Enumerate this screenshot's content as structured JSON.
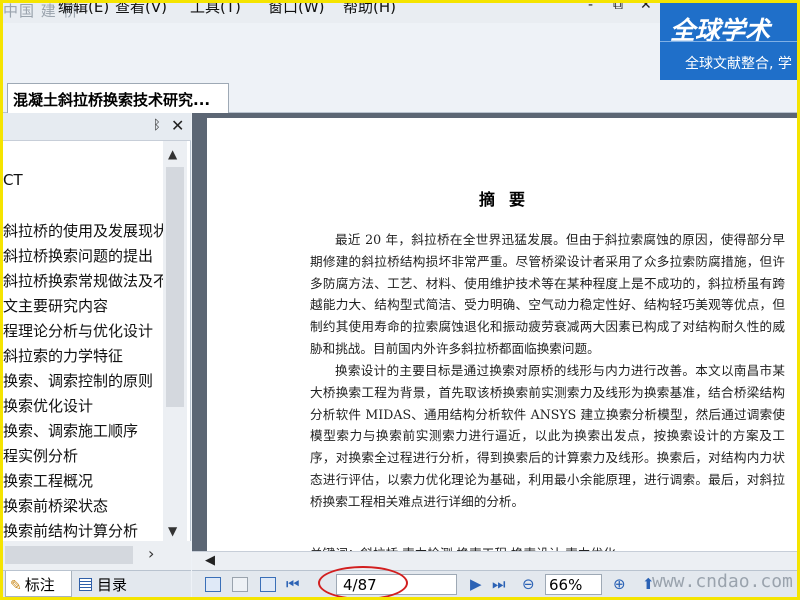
{
  "watermark_top": "中国 建 桥",
  "menu": [
    "编辑(E)",
    "查看(V)",
    "工具(T)",
    "窗口(W)",
    "帮助(H)"
  ],
  "window_controls": {
    "minimize": "-",
    "restore": "⧉",
    "close": "✕"
  },
  "banner": {
    "logo": "全球学术",
    "subtitle": "全球文献整合, 学"
  },
  "doc_tab": {
    "title": "混凝土斜拉桥换索技术研究..."
  },
  "panel": {
    "pin": "ᛒ",
    "close": "✕",
    "toc": [
      "CT",
      "斜拉桥的使用及发展现状",
      "斜拉桥换索问题的提出",
      "斜拉桥换索常规做法及不足",
      "文主要研究内容",
      "程理论分析与优化设计",
      "斜拉索的力学特征",
      "换索、调索控制的原则",
      "换索优化设计",
      "换索、调索施工顺序",
      "程实例分析",
      "换索工程概况",
      "换索前桥梁状态",
      "换索前结构计算分析"
    ],
    "tabs": [
      {
        "label": "标注",
        "icon": "pen-icon"
      },
      {
        "label": "目录",
        "icon": "grid-icon"
      }
    ]
  },
  "page": {
    "title": "摘要",
    "paragraphs": [
      "最近 20 年，斜拉桥在全世界迅猛发展。但由于斜拉索腐蚀的原因，使得部分早期修建的斜拉桥结构损坏非常严重。尽管桥梁设计者采用了众多拉索防腐措施，但许多防腐方法、工艺、材料、使用维护技术等在某种程度上是不成功的，斜拉桥虽有跨越能力大、结构型式简洁、受力明确、空气动力稳定性好、结构轻巧美观等优点，但制约其使用寿命的拉索腐蚀退化和振动疲劳衰减两大因素已构成了对结构耐久性的威胁和挑战。目前国内外许多斜拉桥都面临换索问题。",
      "换索设计的主要目标是通过换索对原桥的线形与内力进行改善。本文以南昌市某大桥换索工程为背景，首先取该桥换索前实测索力及线形为换索基准，结合桥梁结构分析软件 MIDAS、通用结构分析软件 ANSYS 建立换索分析模型，然后通过调索使模型索力与换索前实测索力进行逼近，以此为换索出发点，按换索设计的方案及工序，对换索全过程进行分析，得到换索后的计算索力及线形。换索后，对结构内力状态进行评估，以索力优化理论为基础，利用最小余能原理，进行调索。最后，对斜拉桥换索工程相关难点进行详细的分析。"
    ],
    "keywords": "关键词：斜拉桥     索力检测     换索工程     换索设计     索力优化"
  },
  "status": {
    "page": "4/87",
    "zoom": "66%",
    "watermark": "www.cndao.com"
  },
  "colors": {
    "frame": "#f5e400",
    "banner": "#1f6fc9",
    "highlight_ring": "#d21f1f"
  }
}
